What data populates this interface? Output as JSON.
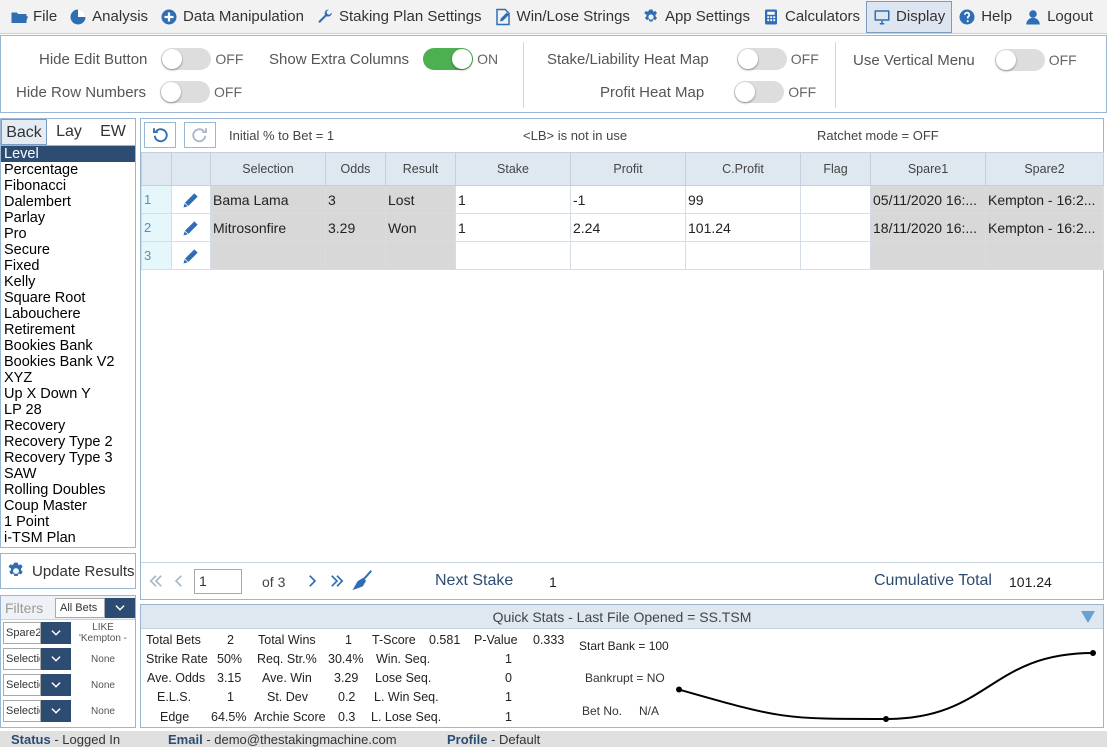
{
  "menu": {
    "items": [
      {
        "name": "file",
        "label": "File"
      },
      {
        "name": "analysis",
        "label": "Analysis"
      },
      {
        "name": "data-manipulation",
        "label": "Data Manipulation"
      },
      {
        "name": "staking-plan-settings",
        "label": "Staking Plan Settings"
      },
      {
        "name": "win-lose-strings",
        "label": "Win/Lose Strings"
      },
      {
        "name": "app-settings",
        "label": "App Settings"
      },
      {
        "name": "calculators",
        "label": "Calculators"
      },
      {
        "name": "display",
        "label": "Display",
        "active": true
      },
      {
        "name": "help",
        "label": "Help"
      },
      {
        "name": "logout",
        "label": "Logout"
      }
    ]
  },
  "options": {
    "hide_edit_button": {
      "label": "Hide Edit Button",
      "state": "OFF"
    },
    "hide_row_numbers": {
      "label": "Hide Row Numbers",
      "state": "OFF"
    },
    "show_extra_columns": {
      "label": "Show Extra Columns",
      "state": "ON"
    },
    "stake_liability_heat_map": {
      "label": "Stake/Liability Heat Map",
      "state": "OFF"
    },
    "profit_heat_map": {
      "label": "Profit Heat Map",
      "state": "OFF"
    },
    "use_vertical_menu": {
      "label": "Use Vertical Menu",
      "state": "OFF"
    }
  },
  "plan_tabs": [
    "Back",
    "Lay",
    "EW"
  ],
  "plans": [
    "Level",
    "Percentage",
    "Fibonacci",
    "Dalembert",
    "Parlay",
    "Pro",
    "Secure",
    "Fixed",
    "Kelly",
    "Square Root",
    "Labouchere",
    "Retirement",
    "Bookies Bank",
    "Bookies Bank V2",
    "XYZ",
    "Up X Down Y",
    "LP 28",
    "Recovery",
    "Recovery Type 2",
    "Recovery Type 3",
    "SAW",
    "Rolling Doubles",
    "Coup Master",
    "1 Point",
    "i-TSM Plan"
  ],
  "update_results_label": "Update Results",
  "filters": {
    "title": "Filters",
    "scope": "All Bets",
    "rows": [
      {
        "field": "Spare2",
        "value": "LIKE 'Kempton -"
      },
      {
        "field": "Selection",
        "value": "None"
      },
      {
        "field": "Selection",
        "value": "None"
      },
      {
        "field": "Selection",
        "value": "None"
      }
    ]
  },
  "grid_toolbar": {
    "initial_pct": "Initial % to Bet = 1",
    "lb": "<LB> is not in use",
    "ratchet": "Ratchet mode = OFF"
  },
  "grid": {
    "columns": [
      "Selection",
      "Odds",
      "Result",
      "Stake",
      "Profit",
      "C.Profit",
      "Flag",
      "Spare1",
      "Spare2"
    ],
    "rows": [
      {
        "n": "1",
        "selection": "Bama Lama",
        "odds": "3",
        "result": "Lost",
        "stake": "1",
        "profit": "-1",
        "cprofit": "99",
        "flag": "",
        "spare1": "05/11/2020 16:...",
        "spare2": "Kempton - 16:2..."
      },
      {
        "n": "2",
        "selection": "Mitrosonfire",
        "odds": "3.29",
        "result": "Won",
        "stake": "1",
        "profit": "2.24",
        "cprofit": "101.24",
        "flag": "",
        "spare1": "18/11/2020 16:...",
        "spare2": "Kempton - 16:2..."
      },
      {
        "n": "3",
        "selection": "",
        "odds": "",
        "result": "",
        "stake": "",
        "profit": "",
        "cprofit": "",
        "flag": "",
        "spare1": "",
        "spare2": ""
      }
    ]
  },
  "pager": {
    "page": "1",
    "of_pages": "of 3",
    "next_stake_label": "Next Stake",
    "next_stake_value": "1",
    "cumulative_label": "Cumulative Total",
    "cumulative_value": "101.24"
  },
  "quick_stats": {
    "title": "Quick Stats - Last File Opened = SS.TSM",
    "total_bets_label": "Total Bets",
    "total_bets": "2",
    "total_wins_label": "Total Wins",
    "total_wins": "1",
    "tscore_label": "T-Score",
    "tscore": "0.581",
    "pvalue_label": "P-Value",
    "pvalue": "0.333",
    "strike_rate_label": "Strike Rate",
    "strike_rate": "50%",
    "req_str_label": "Req. Str.%",
    "req_str": "30.4%",
    "win_seq_label": "Win. Seq.",
    "win_seq": "1",
    "ave_odds_label": "Ave. Odds",
    "ave_odds": "3.15",
    "ave_win_label": "Ave. Win",
    "ave_win": "3.29",
    "lose_seq_label": "Lose Seq.",
    "lose_seq": "0",
    "els_label": "E.L.S.",
    "els": "1",
    "st_dev_label": "St. Dev",
    "st_dev": "0.2",
    "l_win_seq_label": "L. Win Seq.",
    "l_win_seq": "1",
    "edge_label": "Edge",
    "edge": "64.5%",
    "archie_label": "Archie Score",
    "archie": "0.3",
    "l_lose_seq_label": "L. Lose Seq.",
    "l_lose_seq": "1",
    "start_bank": "Start Bank = 100",
    "bankrupt": "Bankrupt = NO",
    "bet_no_label": "Bet No.",
    "bet_no_value": "N/A"
  },
  "chart_data": {
    "type": "line",
    "x": [
      0,
      1,
      2
    ],
    "values": [
      100,
      99,
      101.24
    ],
    "title": "",
    "xlabel": "",
    "ylabel": ""
  },
  "status": {
    "status_label": "Status",
    "status_value": "- Logged In",
    "email_label": "Email",
    "email_value": "- demo@thestakingmachine.com",
    "profile_label": "Profile",
    "profile_value": "- Default"
  }
}
